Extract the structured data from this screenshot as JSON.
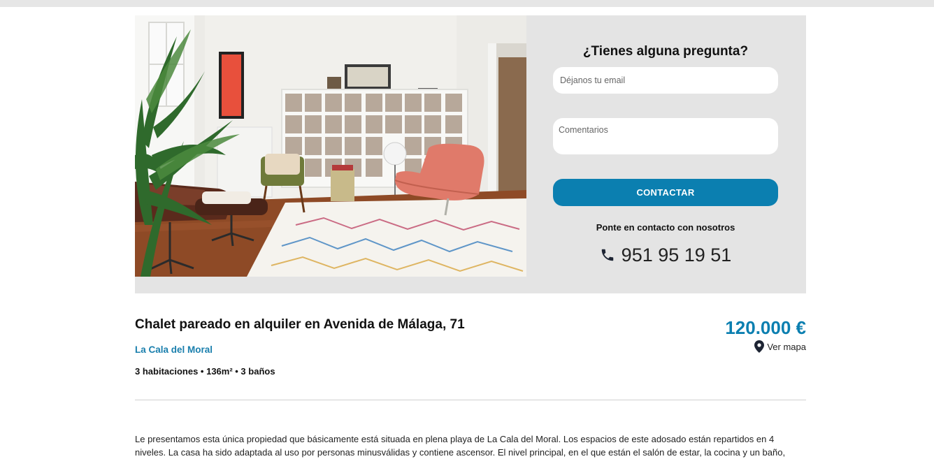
{
  "colors": {
    "accent": "#0b7fb0",
    "panel_bg": "#e4e4e4",
    "link": "#1a7fad"
  },
  "contact_form": {
    "title": "¿Tienes alguna pregunta?",
    "email_placeholder": "Déjanos tu email",
    "comments_placeholder": "Comentarios",
    "submit_label": "CONTACTAR",
    "contact_label": "Ponte en contacto con nosotros",
    "phone_icon": "phone-icon",
    "phone": "951 95 19 51"
  },
  "listing": {
    "title": "Chalet pareado en alquiler en Avenida de Málaga, 71",
    "location": "La Cala del Moral",
    "features": "3 habitaciones • 136m² • 3 baños",
    "price": "120.000 €",
    "map_icon": "map-pin-icon",
    "map_link": "Ver mapa",
    "description": "Le presentamos esta única propiedad que básicamente está situada en plena playa de La Cala del Moral. Los espacios de este adosado están repartidos en 4 niveles. La casa ha sido adaptada al uso por personas minusválidas y contiene ascensor. El nivel principal, en el que están el salón de estar, la cocina y un baño,"
  }
}
